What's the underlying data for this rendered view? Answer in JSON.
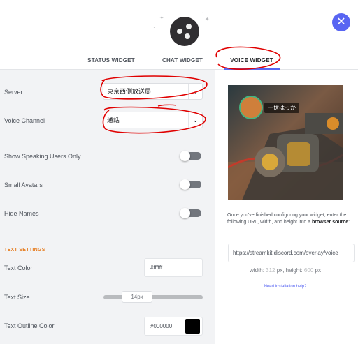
{
  "tabs": [
    {
      "label": "STATUS WIDGET"
    },
    {
      "label": "CHAT WIDGET"
    },
    {
      "label": "VOICE WIDGET",
      "active": true
    }
  ],
  "form": {
    "server": {
      "label": "Server",
      "value": "東京西側放送局"
    },
    "voice_channel": {
      "label": "Voice Channel",
      "value": "通話"
    },
    "show_speaking_only": {
      "label": "Show Speaking Users Only",
      "on": false
    },
    "small_avatars": {
      "label": "Small Avatars",
      "on": false
    },
    "hide_names": {
      "label": "Hide Names",
      "on": false
    }
  },
  "text_settings": {
    "title": "TEXT SETTINGS",
    "text_color": {
      "label": "Text Color",
      "value": "#ffffff"
    },
    "text_size": {
      "label": "Text Size",
      "value": "14px"
    },
    "outline_color": {
      "label": "Text Outline Color",
      "value": "#000000"
    }
  },
  "preview": {
    "speaker_name": "一伏はっか"
  },
  "instructions": {
    "text": "Once you've finished configuring your widget, enter the following URL, width, and height into a",
    "bold": "browser source",
    "end": ":"
  },
  "url": "https://streamkit.discord.com/overlay/voice",
  "dimensions": {
    "width_label": "width:",
    "width_value": "312",
    "height_label": "height:",
    "height_value": "600",
    "unit": "px"
  },
  "help_link": "Need installation help?",
  "colors": {
    "accent": "#5865f2",
    "section_title": "#e67e22",
    "annotation": "#e00000"
  }
}
